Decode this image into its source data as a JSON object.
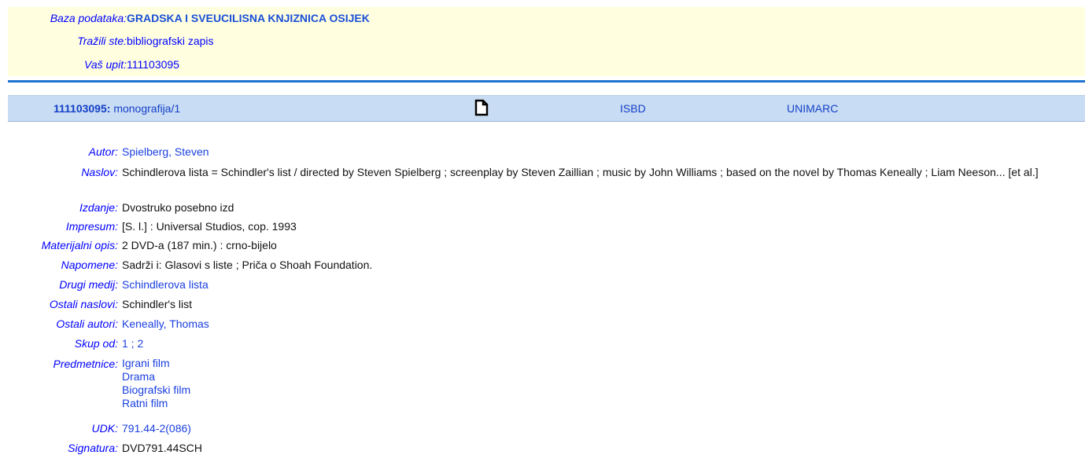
{
  "header": {
    "database_label": "Baza podataka:",
    "database_value": "GRADSKA I SVEUCILISNA KNJIZNICA OSIJEK",
    "searched_label": "Tražili ste:",
    "searched_value": "bibliografski zapis",
    "query_label": "Vaš upit:",
    "query_value": "111103095"
  },
  "record_bar": {
    "id": "111103095:",
    "type": "monografija/1",
    "isbd": "ISBD",
    "unimarc": "UNIMARC"
  },
  "record": {
    "author_label": "Autor:",
    "author_value": "Spielberg, Steven",
    "title_label": "Naslov:",
    "title_value": "Schindlerova lista = Schindler's list / directed by Steven Spielberg ; screenplay by Steven Zaillian ; music by John Williams ; based on the novel by Thomas Keneally ; Liam Neeson... [et al.]",
    "edition_label": "Izdanje:",
    "edition_value": "Dvostruko posebno izd",
    "imprint_label": "Impresum:",
    "imprint_value": "[S. l.] : Universal Studios, cop. 1993",
    "physical_label": "Materijalni opis:",
    "physical_value": "2 DVD-a (187 min.) : crno-bijelo",
    "notes_label": "Napomene:",
    "notes_value": "Sadrži i: Glasovi s liste ; Priča o Shoah Foundation.",
    "other_media_label": "Drugi medij:",
    "other_media_value": "Schindlerova lista",
    "other_titles_label": "Ostali naslovi:",
    "other_titles_value": "Schindler's list",
    "other_authors_label": "Ostali autori:",
    "other_authors_value": "Keneally, Thomas",
    "set_label": "Skup od:",
    "set_value": "1 ; 2",
    "subjects_label": "Predmetnice:",
    "subjects": [
      "Igrani film",
      "Drama",
      "Biografski film",
      "Ratni film"
    ],
    "udk_label": "UDK:",
    "udk_value": "791.44-2(086)",
    "call_label": "Signatura:",
    "call_value": "DVD791.44SCH"
  }
}
